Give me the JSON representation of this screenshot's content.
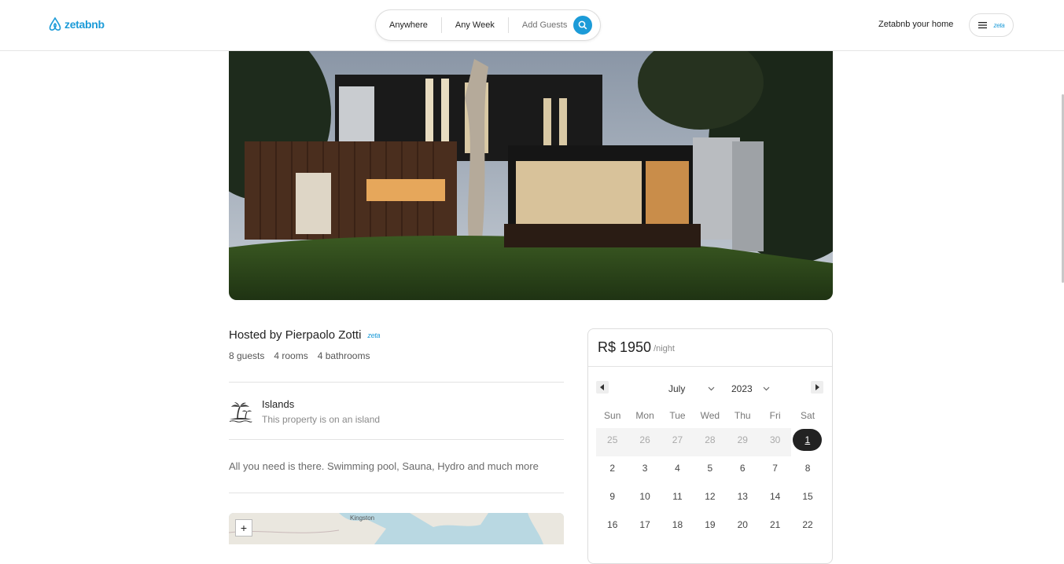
{
  "brand": {
    "name": "zetabnb",
    "color": "#1c9bd8"
  },
  "search": {
    "anywhere": "Anywhere",
    "any_week": "Any Week",
    "add_guests": "Add Guests"
  },
  "nav": {
    "host_link": "Zetabnb your home",
    "avatar_text": "zeta"
  },
  "listing": {
    "host": "Hosted by Pierpaolo Zotti",
    "host_badge": "zeta",
    "stats": {
      "guests": "8 guests",
      "rooms": "4 rooms",
      "bathrooms": "4 bathrooms"
    },
    "category": {
      "title": "Islands",
      "subtitle": "This property is on an island",
      "icon": "palm-island-icon"
    },
    "description": "All you need is there. Swimming pool, Sauna, Hydro and much more",
    "map": {
      "label": "Kingston",
      "zoom_in": "+"
    }
  },
  "booking": {
    "price": "R$ 1950",
    "per": "/night",
    "month": "July",
    "year": "2023",
    "weekdays": [
      "Sun",
      "Mon",
      "Tue",
      "Wed",
      "Thu",
      "Fri",
      "Sat"
    ],
    "weeks": [
      [
        {
          "d": "25",
          "out": true
        },
        {
          "d": "26",
          "out": true
        },
        {
          "d": "27",
          "out": true
        },
        {
          "d": "28",
          "out": true
        },
        {
          "d": "29",
          "out": true
        },
        {
          "d": "30",
          "out": true
        },
        {
          "d": "1",
          "selected": true
        }
      ],
      [
        {
          "d": "2"
        },
        {
          "d": "3"
        },
        {
          "d": "4"
        },
        {
          "d": "5"
        },
        {
          "d": "6"
        },
        {
          "d": "7"
        },
        {
          "d": "8"
        }
      ],
      [
        {
          "d": "9"
        },
        {
          "d": "10"
        },
        {
          "d": "11"
        },
        {
          "d": "12"
        },
        {
          "d": "13"
        },
        {
          "d": "14"
        },
        {
          "d": "15"
        }
      ],
      [
        {
          "d": "16"
        },
        {
          "d": "17"
        },
        {
          "d": "18"
        },
        {
          "d": "19"
        },
        {
          "d": "20"
        },
        {
          "d": "21"
        },
        {
          "d": "22"
        }
      ]
    ]
  }
}
